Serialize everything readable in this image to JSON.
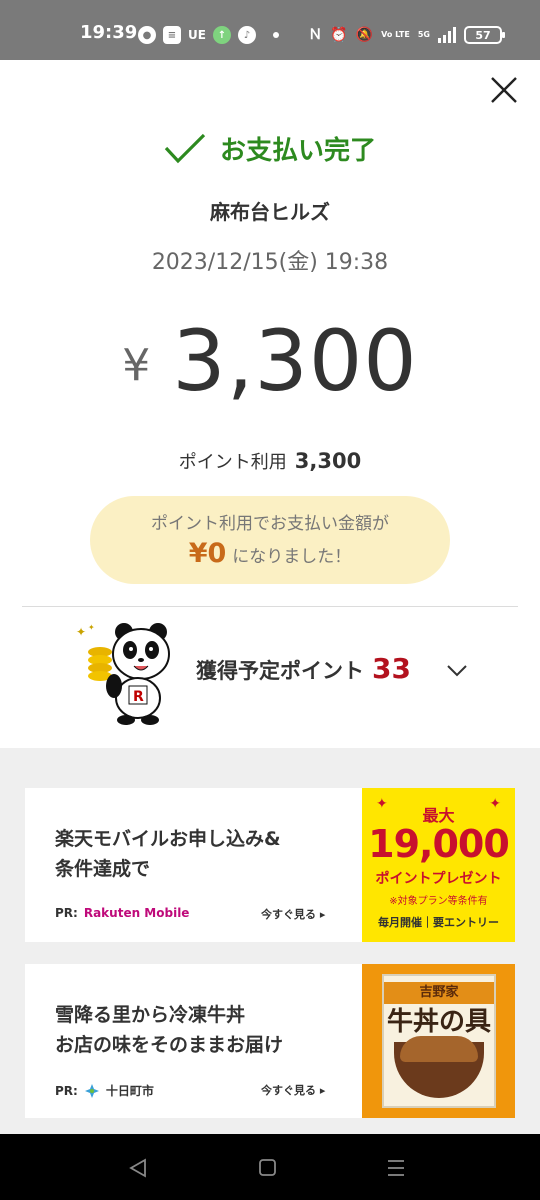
{
  "status_bar": {
    "time": "19:39",
    "ue_text": "UE",
    "volte_text": "Vo LTE",
    "network_text": "5G",
    "battery": "57"
  },
  "payment": {
    "status_label": "お支払い完了",
    "merchant": "麻布台ヒルズ",
    "datetime": "2023/12/15(金) 19:38",
    "currency_symbol": "¥",
    "amount": "3,300",
    "point_use_label": "ポイント利用",
    "point_use_value": "3,300",
    "notice_line1": "ポイント利用でお支払い金額が",
    "notice_amount": "¥0",
    "notice_suffix": "になりました！",
    "earn_label": "獲得予定ポイント",
    "earn_value": "33"
  },
  "ads": [
    {
      "title_line1": "楽天モバイルお申し込み&",
      "title_line2": "条件達成で",
      "pr_label": "PR:",
      "sponsor": "Rakuten Mobile",
      "cta": "今すぐ見る ▸",
      "image": {
        "top": "最大",
        "big": "19,000",
        "mid": "ポイントプレゼント",
        "note": "※対象プラン等条件有",
        "bottom": "毎月開催｜要エントリー"
      }
    },
    {
      "title_line1": "雪降る里から冷凍牛丼",
      "title_line2": "お店の味をそのままお届け",
      "pr_label": "PR:",
      "sponsor": "十日町市",
      "cta": "今すぐ見る ▸",
      "image": {
        "brand": "吉野家",
        "dish": "牛丼の具"
      }
    }
  ],
  "colors": {
    "success_green": "#2d8a1f",
    "points_red": "#b3121e",
    "notice_bg": "#fbf0c4",
    "notice_amount": "#c86a1a",
    "rakuten_yellow": "#ffe600"
  }
}
